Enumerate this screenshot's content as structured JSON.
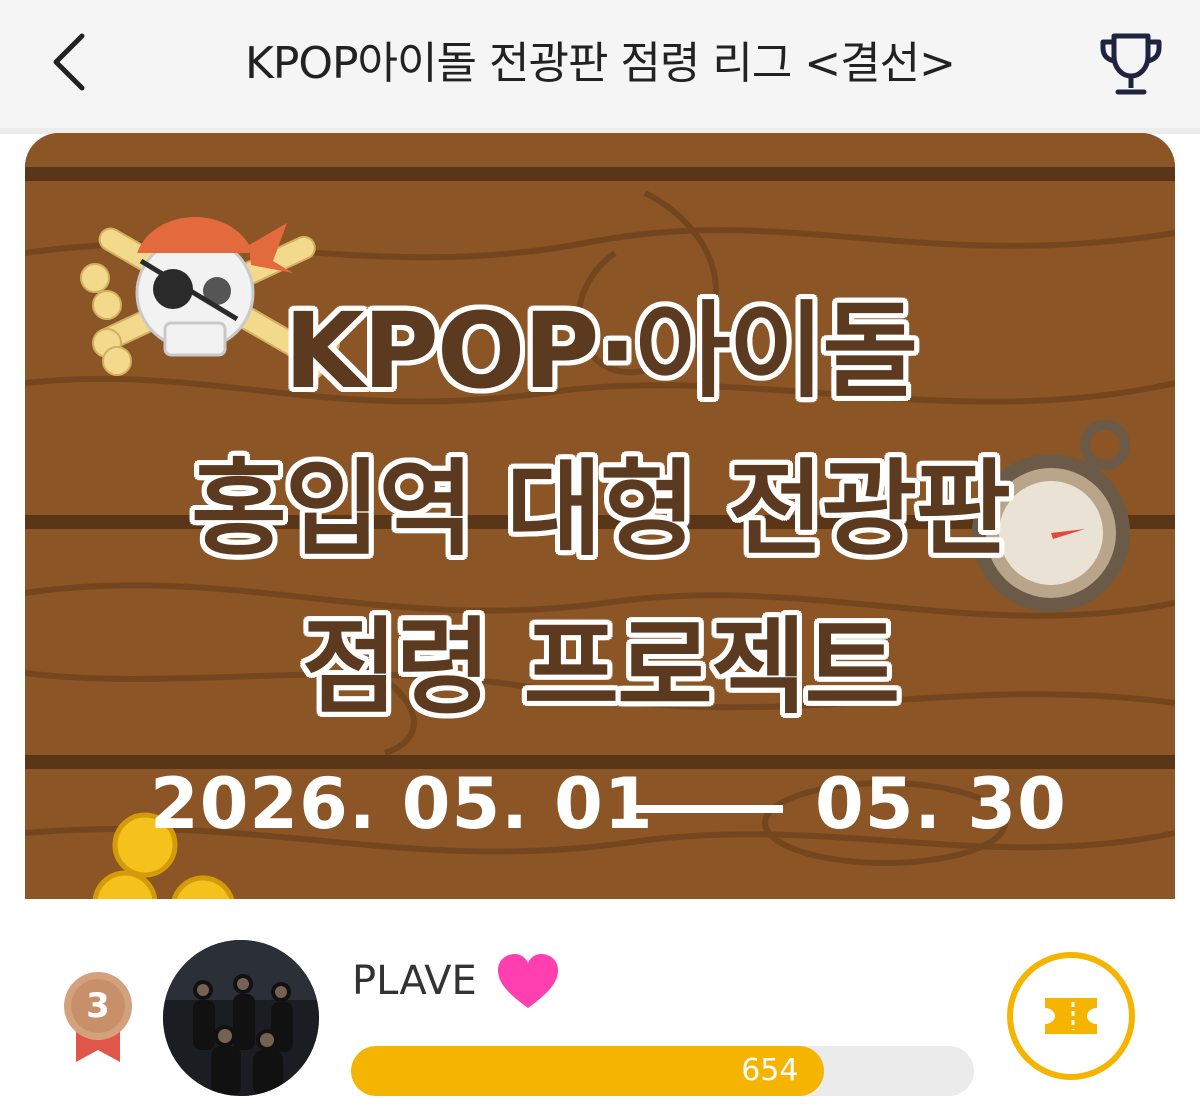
{
  "header": {
    "title": "KPOP아이돌 전광판 점령 리그 <결선>",
    "back_icon": "chevron-left-icon",
    "trophy_icon": "trophy-icon"
  },
  "banner": {
    "title_line1": "KPOP·아이돌",
    "title_line2": "홍입역 대형 전광판",
    "title_line3": "점령 프로젝트",
    "date_start": "2026. 05. 01",
    "date_end": "05. 30",
    "colors": {
      "wood": "#8b5526",
      "text": "#5b3a1f"
    }
  },
  "ranking": {
    "rank": "3",
    "artist": "PLAVE",
    "votes": "654",
    "progress": 0.76,
    "colors": {
      "bar_fill": "#f5b400",
      "bar_track": "#ebebeb",
      "heart": "#ff3fb0",
      "medal": "#d3a27c"
    },
    "icons": {
      "heart": "heart-icon",
      "ticket": "ticket-icon",
      "medal": "bronze-medal-icon"
    }
  }
}
